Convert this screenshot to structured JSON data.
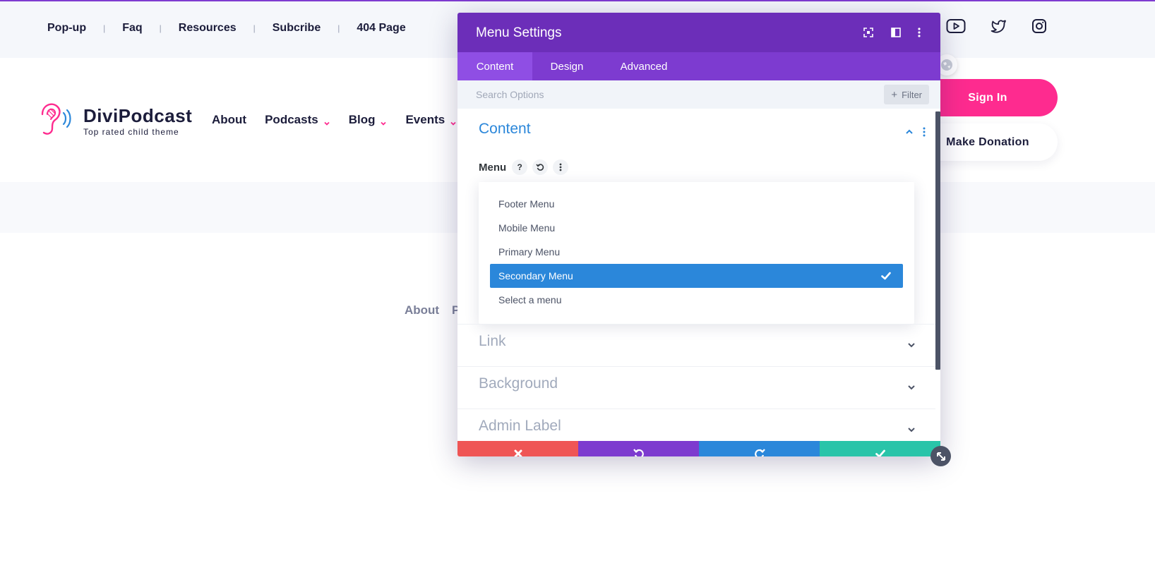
{
  "topbar": {
    "links": [
      "Pop-up",
      "Faq",
      "Resources",
      "Subcribe",
      "404 Page"
    ],
    "separator": "|",
    "social_icons": [
      "youtube-icon",
      "twitter-icon",
      "instagram-icon"
    ]
  },
  "brand": {
    "name": "DiviPodcast",
    "tagline": "Top rated child theme",
    "logo_icon": "ear-sound-icon"
  },
  "main_nav": {
    "items": [
      {
        "label": "About",
        "has_dropdown": false
      },
      {
        "label": "Podcasts",
        "has_dropdown": true
      },
      {
        "label": "Blog",
        "has_dropdown": true
      },
      {
        "label": "Events",
        "has_dropdown": true
      }
    ]
  },
  "buttons": {
    "sign_in": "Sign In",
    "donate": "Make Donation"
  },
  "footer_preview": {
    "about": "About",
    "partial": "P"
  },
  "modal": {
    "title": "Menu Settings",
    "tabs": [
      "Content",
      "Design",
      "Advanced"
    ],
    "active_tab": "Content",
    "search": {
      "placeholder": "Search Options"
    },
    "filter_label": "Filter",
    "sections": {
      "content": {
        "title": "Content",
        "open": true
      },
      "link": {
        "title": "Link",
        "open": false
      },
      "background": {
        "title": "Background",
        "open": false
      },
      "admin_label": {
        "title": "Admin Label",
        "open": false
      }
    },
    "menu_field": {
      "label": "Menu",
      "help": "?",
      "options": [
        "Footer Menu",
        "Mobile Menu",
        "Primary Menu",
        "Secondary Menu",
        "Select a menu"
      ],
      "selected": "Secondary Menu"
    },
    "colors": {
      "header": "#6c2eb9",
      "tabs": "#7d3bd0",
      "active_tab": "#8f4ee4",
      "selected_option": "#2b87da",
      "discard": "#ef5555",
      "undo": "#7d3bcf",
      "redo": "#2b87da",
      "save": "#29c4a9"
    }
  },
  "colors": {
    "brand_pink": "#fe2b8f",
    "dark_navy": "#1c1d3b"
  }
}
